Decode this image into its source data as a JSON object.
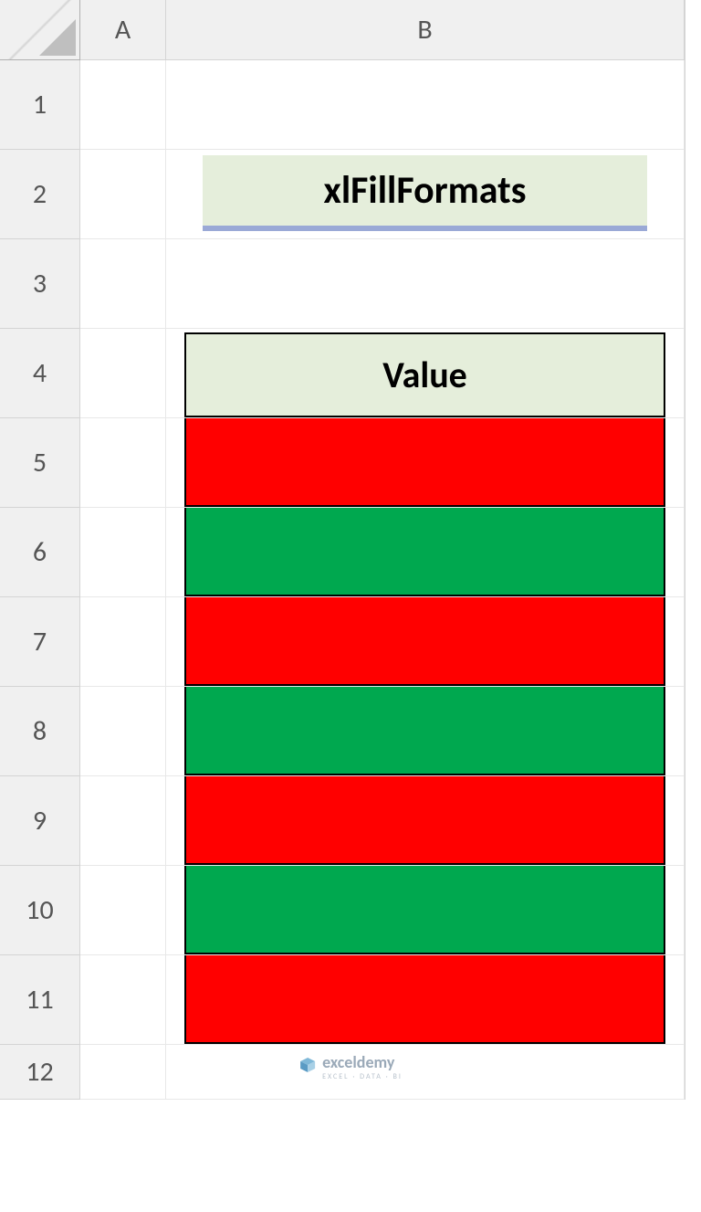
{
  "columns": [
    "A",
    "B"
  ],
  "rows": [
    "1",
    "2",
    "3",
    "4",
    "5",
    "6",
    "7",
    "8",
    "9",
    "10",
    "11",
    "12"
  ],
  "title": "xlFillFormats",
  "header": "Value",
  "fills": [
    "red",
    "green",
    "red",
    "green",
    "red",
    "green",
    "red"
  ],
  "watermark": {
    "name": "exceldemy",
    "tag": "EXCEL · DATA · BI"
  },
  "colors": {
    "red": "#ff0000",
    "green": "#00a84f",
    "titleBg": "#e5eedb",
    "titleUnderline": "#9aa9d6"
  }
}
